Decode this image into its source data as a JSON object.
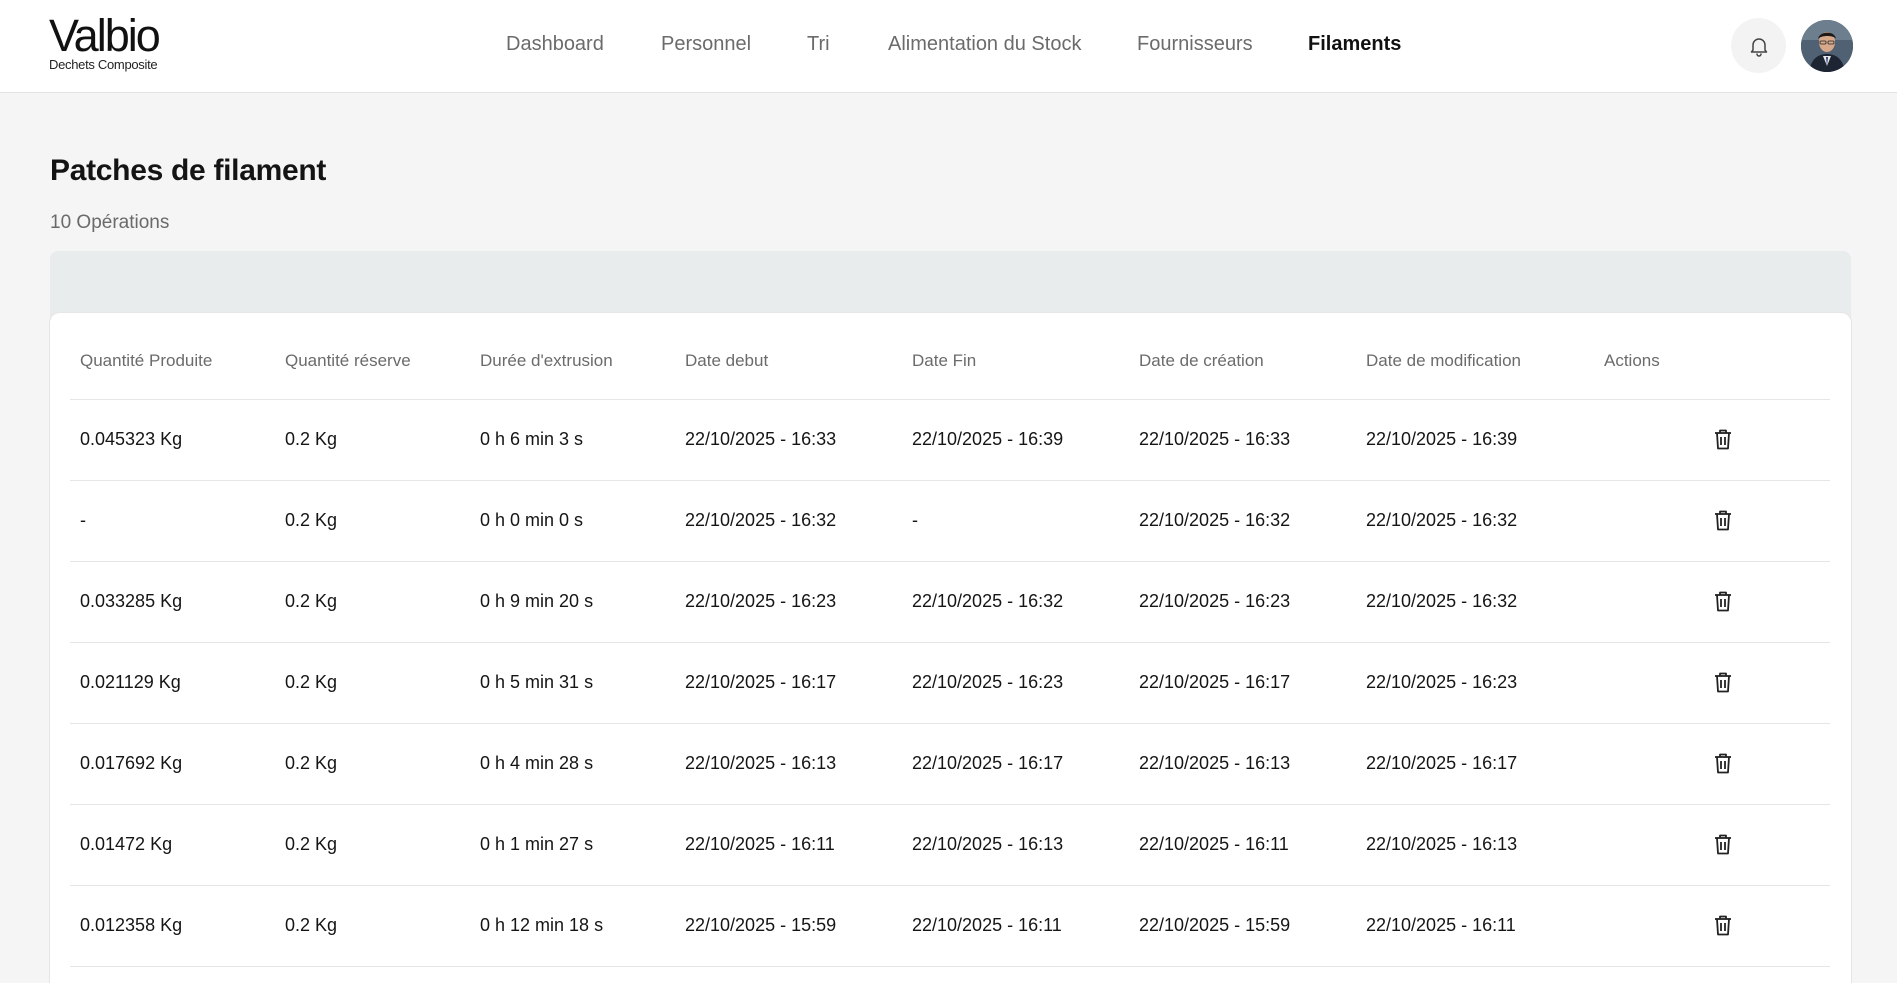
{
  "header": {
    "logo_text": "Valbio",
    "logo_subtitle": "Dechets Composite",
    "nav": [
      {
        "label": "Dashboard",
        "active": false
      },
      {
        "label": "Personnel",
        "active": false
      },
      {
        "label": "Tri",
        "active": false
      },
      {
        "label": "Alimentation du Stock",
        "active": false
      },
      {
        "label": "Fournisseurs",
        "active": false
      },
      {
        "label": "Filaments",
        "active": true
      }
    ],
    "notification_icon": "bell-icon",
    "avatar_icon": "user-avatar"
  },
  "page": {
    "title": "Patches de filament",
    "subtitle": "10 Opérations"
  },
  "table": {
    "columns": [
      "Quantité Produite",
      "Quantité réserve",
      "Durée d'extrusion",
      "Date debut",
      "Date Fin",
      "Date de création",
      "Date de modification",
      "Actions"
    ],
    "rows": [
      [
        "0.045323 Kg",
        "0.2 Kg",
        "0 h 6 min 3 s",
        "22/10/2025 - 16:33",
        "22/10/2025 - 16:39",
        "22/10/2025 - 16:33",
        "22/10/2025 - 16:39"
      ],
      [
        "-",
        "0.2 Kg",
        "0 h 0 min 0 s",
        "22/10/2025 - 16:32",
        "-",
        "22/10/2025 - 16:32",
        "22/10/2025 - 16:32"
      ],
      [
        "0.033285 Kg",
        "0.2 Kg",
        "0 h 9 min 20 s",
        "22/10/2025 - 16:23",
        "22/10/2025 - 16:32",
        "22/10/2025 - 16:23",
        "22/10/2025 - 16:32"
      ],
      [
        "0.021129 Kg",
        "0.2 Kg",
        "0 h 5 min 31 s",
        "22/10/2025 - 16:17",
        "22/10/2025 - 16:23",
        "22/10/2025 - 16:17",
        "22/10/2025 - 16:23"
      ],
      [
        "0.017692 Kg",
        "0.2 Kg",
        "0 h 4 min 28 s",
        "22/10/2025 - 16:13",
        "22/10/2025 - 16:17",
        "22/10/2025 - 16:13",
        "22/10/2025 - 16:17"
      ],
      [
        "0.01472 Kg",
        "0.2 Kg",
        "0 h 1 min 27 s",
        "22/10/2025 - 16:11",
        "22/10/2025 - 16:13",
        "22/10/2025 - 16:11",
        "22/10/2025 - 16:13"
      ],
      [
        "0.012358 Kg",
        "0.2 Kg",
        "0 h 12 min 18 s",
        "22/10/2025 - 15:59",
        "22/10/2025 - 16:11",
        "22/10/2025 - 15:59",
        "22/10/2025 - 16:11"
      ]
    ],
    "row_action_icon": "trash-icon"
  },
  "colors": {
    "background": "#f5f5f5",
    "card": "#ffffff",
    "band": "#e9ecec",
    "text": "#151515",
    "muted": "#6b6b6b"
  }
}
